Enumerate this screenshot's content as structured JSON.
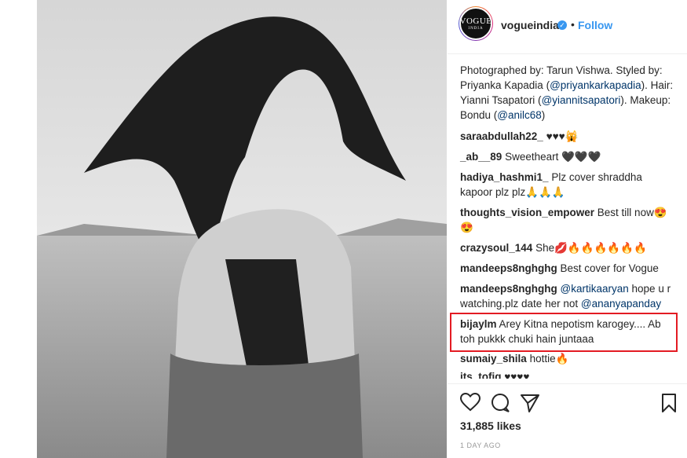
{
  "post": {
    "username": "vogueindia",
    "follow_label": "Follow",
    "separator": "•",
    "avatar_text": "VOGUE",
    "avatar_subtext": "INDIA",
    "verified_symbol": "✓"
  },
  "caption": {
    "prefix": "Photographed by: Tarun Vishwa. Styled by: Priyanka Kapadia (",
    "mention1": "@priyankarkapadia",
    "mid1": "). Hair: Yianni Tsapatori (",
    "mention2": "@yiannitsapatori",
    "mid2": "). Makeup: Bondu (",
    "mention3": "@anilc68",
    "suffix": ")"
  },
  "comments": [
    {
      "user": "saraabdullah22_",
      "text": "♥♥♥🙀"
    },
    {
      "user": "_ab__89",
      "text": "Sweetheart 🖤🖤🖤"
    },
    {
      "user": "hadiya_hashmi1_",
      "text": "Plz cover shraddha kapoor plz plz🙏🙏🙏"
    },
    {
      "user": "thoughts_vision_empower",
      "text": "Best till now😍 😍"
    },
    {
      "user": "crazysoul_144",
      "text": "She💋🔥🔥🔥🔥🔥🔥"
    },
    {
      "user": "mandeeps8nghghg",
      "text": "Best cover for Vogue"
    },
    {
      "user": "mandeeps8nghghg",
      "text_pre": "",
      "mention1": "@kartikaaryan",
      "mid": " hope u r watching.plz date her not ",
      "mention2": "@ananyapanday"
    },
    {
      "user": "bijaylm",
      "text": "Arey Kitna nepotism karogey.... Ab toh pukkk chuki hain juntaaa"
    },
    {
      "user": "sumaiy_shila",
      "text": "hottie🔥"
    },
    {
      "user": "its_tofiq",
      "text": "♥♥♥♥"
    }
  ],
  "likes": "31,885 likes",
  "time_ago": "1 DAY AGO",
  "colors": {
    "link": "#3897f0",
    "mention": "#003569",
    "highlight": "#e31b23"
  }
}
